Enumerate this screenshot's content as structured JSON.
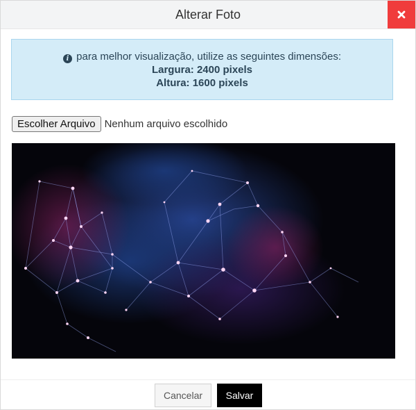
{
  "modal": {
    "title": "Alterar Foto",
    "close_icon": "close-icon"
  },
  "info": {
    "icon": "info-circle-icon",
    "message": "para melhor visualização, utilize as seguintes dimensões:",
    "width_label": "Largura: 2400 pixels",
    "height_label": "Altura: 1600 pixels"
  },
  "file_input": {
    "button_label": "Escolher Arquivo",
    "status": "Nenhum arquivo escolhido"
  },
  "preview": {
    "description": "abstract network image",
    "colors": {
      "background": "#05050b",
      "glow_blue": "#2a4a9e",
      "glow_magenta": "#7a1f5a",
      "node": "#ffd6f5",
      "line": "#9fb0ff"
    }
  },
  "footer": {
    "cancel_label": "Cancelar",
    "save_label": "Salvar"
  },
  "colors": {
    "close_bg": "#f03c3c",
    "info_bg": "#d4ecf8",
    "save_bg": "#000000"
  }
}
